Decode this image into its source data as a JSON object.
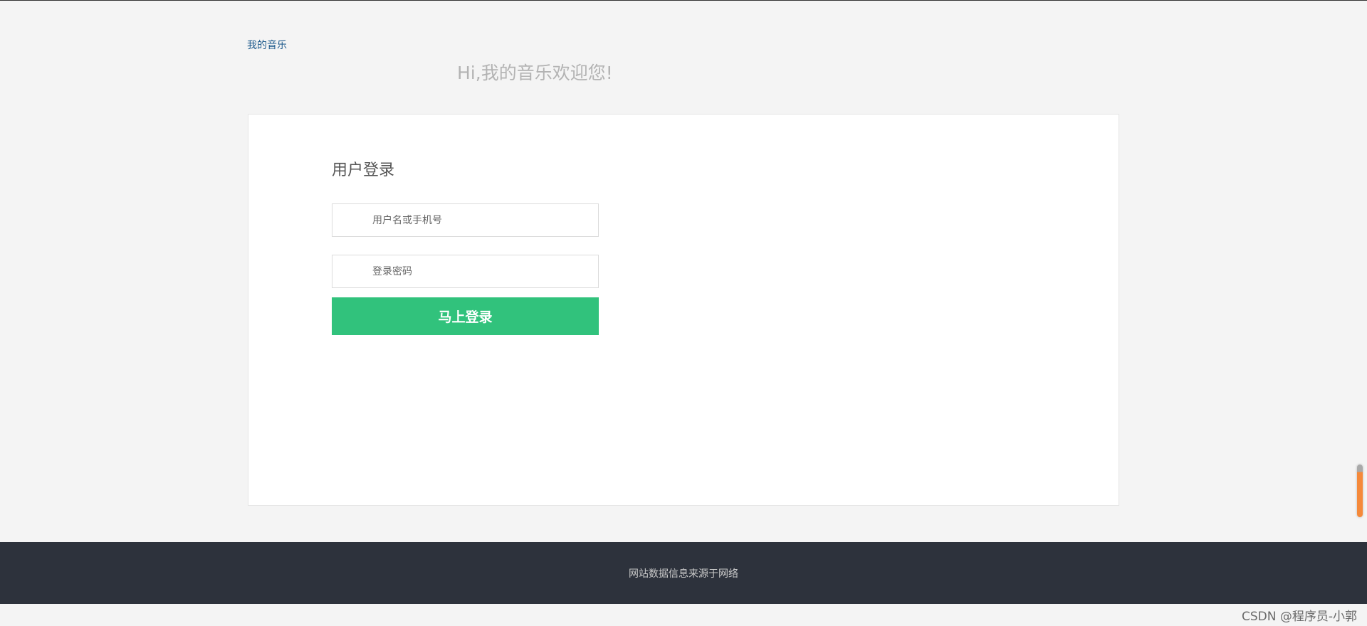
{
  "header": {
    "logo_link": "我的音乐",
    "welcome": "Hi,我的音乐欢迎您!"
  },
  "login": {
    "title": "用户登录",
    "username_placeholder": "用户名或手机号",
    "username_value": "",
    "password_placeholder": "登录密码",
    "password_value": "",
    "submit_label": "马上登录"
  },
  "footer": {
    "text": "网站数据信息来源于网络"
  },
  "watermark": "CSDN @程序员-小郭",
  "colors": {
    "accent": "#31c27c",
    "footer_bg": "#2d323c",
    "page_bg": "#f4f4f4",
    "link": "#1e5a8c",
    "scroll_handle": "#f5893a"
  }
}
